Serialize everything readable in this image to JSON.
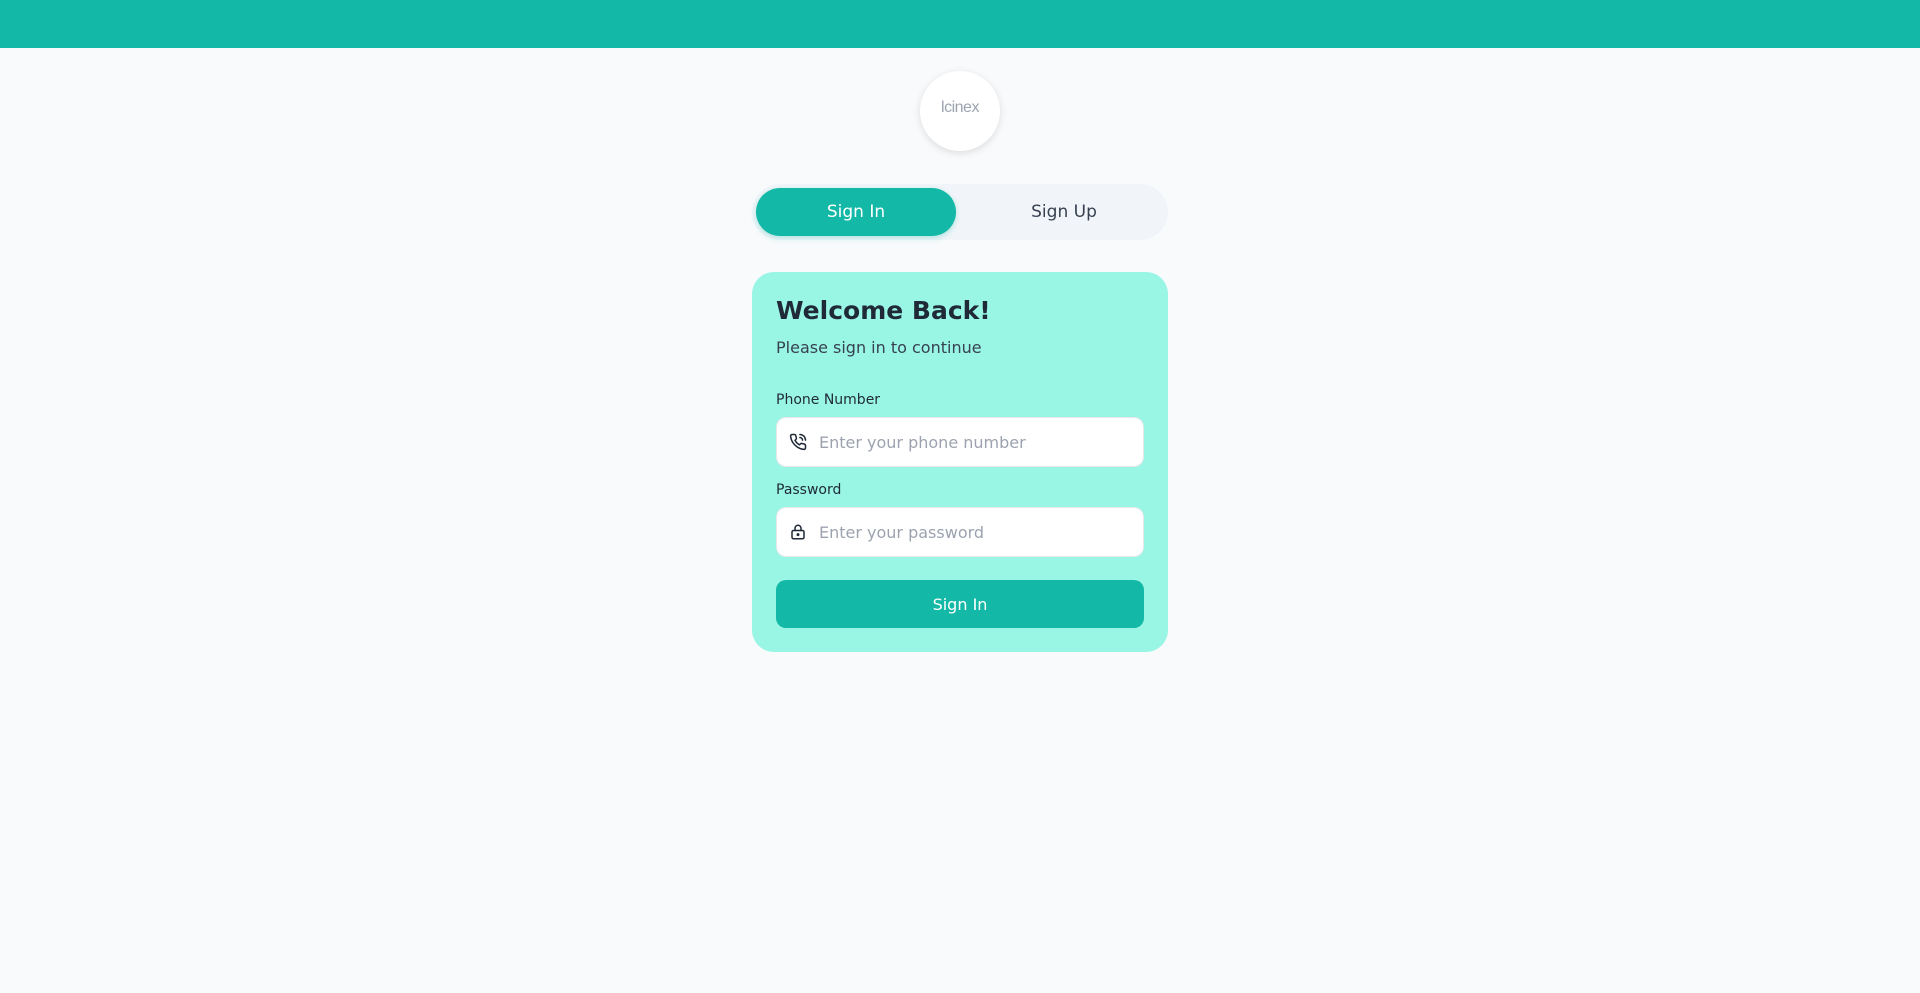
{
  "logo": {
    "text": "lcinex"
  },
  "tabs": {
    "signin_label": "Sign In",
    "signup_label": "Sign Up",
    "active": "signin"
  },
  "card": {
    "title": "Welcome Back!",
    "subtitle": "Please sign in to continue",
    "phone": {
      "label": "Phone Number",
      "placeholder": "Enter your phone number",
      "value": "",
      "icon": "phone-icon"
    },
    "password": {
      "label": "Password",
      "placeholder": "Enter your password",
      "value": "",
      "icon": "lock-icon"
    },
    "submit_label": "Sign In"
  },
  "colors": {
    "accent": "#14b8a6",
    "card_bg": "#99f6e4",
    "page_bg": "#f8fafc"
  }
}
